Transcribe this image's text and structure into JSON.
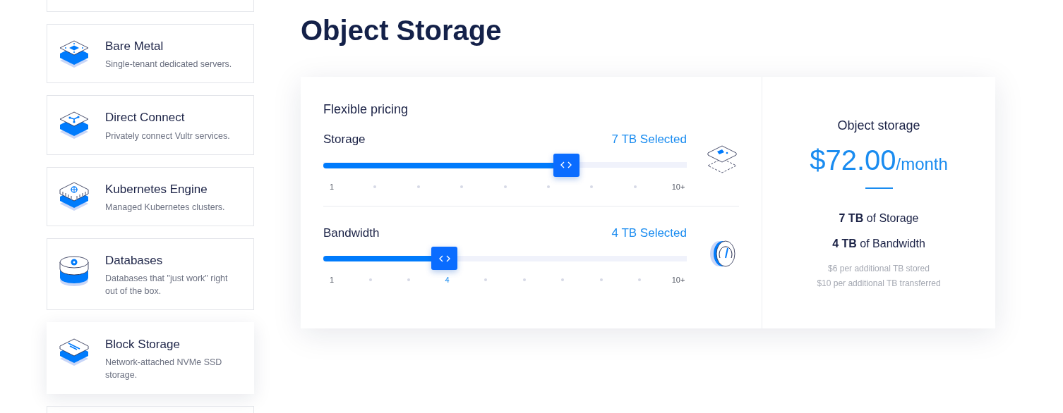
{
  "sidebar": {
    "items": [
      {
        "title": "Bare Metal",
        "description": "Single-tenant dedicated servers.",
        "selected": false
      },
      {
        "title": "Direct Connect",
        "description": "Privately connect Vultr services.",
        "selected": false
      },
      {
        "title": "Kubernetes Engine",
        "description": "Managed Kubernetes clusters.",
        "selected": false
      },
      {
        "title": "Databases",
        "description": "Databases that \"just work\" right out of the box.",
        "selected": false
      },
      {
        "title": "Block Storage",
        "description": "Network-attached NVMe SSD storage.",
        "selected": true
      }
    ]
  },
  "page": {
    "title": "Object Storage"
  },
  "pricing": {
    "title": "Flexible pricing",
    "sliders": [
      {
        "label": "Storage",
        "reading": "7 TB Selected",
        "level": 0.667,
        "ticks": [
          {
            "kind": "label",
            "label": "1",
            "selected": false
          },
          {
            "kind": "dot"
          },
          {
            "kind": "dot"
          },
          {
            "kind": "dot"
          },
          {
            "kind": "dot"
          },
          {
            "kind": "dot"
          },
          {
            "kind": "dot"
          },
          {
            "kind": "dot"
          },
          {
            "kind": "label",
            "label": "10+",
            "selected": false
          }
        ]
      },
      {
        "label": "Bandwidth",
        "reading": "4 TB Selected",
        "level": 0.333,
        "ticks": [
          {
            "kind": "label",
            "label": "1",
            "selected": false
          },
          {
            "kind": "dot"
          },
          {
            "kind": "dot"
          },
          {
            "kind": "label",
            "label": "4",
            "selected": true
          },
          {
            "kind": "dot"
          },
          {
            "kind": "dot"
          },
          {
            "kind": "dot"
          },
          {
            "kind": "dot"
          },
          {
            "kind": "dot"
          },
          {
            "kind": "label",
            "label": "10+",
            "selected": false
          }
        ]
      }
    ]
  },
  "summary": {
    "title": "Object storage",
    "price": "$72.00",
    "period": "/month",
    "includes": [
      "**7 TB** of Storage",
      "**4 TB** of Bandwidth"
    ],
    "notes": [
      "$6 per additional TB stored",
      "$10 per additional TB transferred"
    ]
  }
}
